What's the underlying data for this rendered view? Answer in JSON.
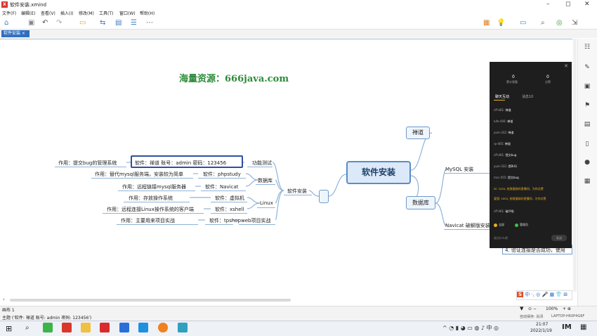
{
  "window": {
    "title": "软件安装.xmind",
    "app_icon": "X"
  },
  "menu": [
    "文件(F)",
    "编辑(E)",
    "查看(V)",
    "插入(I)",
    "修改(M)",
    "工具(T)",
    "窗口(W)",
    "帮助(H)"
  ],
  "tabs": [
    {
      "label": "软件安装 ×"
    }
  ],
  "watermark": "海量资源：666java.com",
  "mindmap": {
    "central": "软件安装",
    "right": {
      "chandao": "禅道",
      "database": "数据库",
      "mysql_install": "MySQL 安装",
      "navicat_crack": "Navicat 破解版安装",
      "verify_step": "4. 验证连接是否成功，使用"
    },
    "left": {
      "software_install": "软件安装",
      "func_test": "功能测试",
      "database": "数据库",
      "linux": "Linux",
      "web_project": "web项目实战",
      "rows": [
        {
          "desc": "作用：提交bug的管理系统",
          "soft": "软件：禅道   账号：admin   密码：123456"
        },
        {
          "desc": "作用：替代mysql服务端，安装较为简单",
          "soft": "软件：phpstudy"
        },
        {
          "desc": "作用：远程链接mysql服务器",
          "soft": "软件：Navicat"
        },
        {
          "desc": "作用：存放操作系统",
          "soft": "软件：虚拟机"
        },
        {
          "desc": "作用：远程连接Linux操作系统的客户端",
          "soft": "软件：xshell"
        },
        {
          "desc": "作用：主要用来项目实战",
          "soft": "软件：tpshop"
        }
      ]
    }
  },
  "chat": {
    "stat1_value": "0",
    "stat1_label": "累计观看",
    "stat2_value": "0",
    "stat2_label": "点赞",
    "tab_live": "聊天互动",
    "tab_msg": "消息10",
    "messages": [
      {
        "user": "cff-461:",
        "text": "禅道"
      },
      {
        "user": "lufe-456:",
        "text": "禅道"
      },
      {
        "user": "yum-332:",
        "text": "禅道"
      },
      {
        "user": "rp-465:",
        "text": "禅道"
      },
      {
        "user": "cff-461:",
        "text": "提交bug"
      },
      {
        "user": "yum-332:",
        "text": "提BUG"
      },
      {
        "user": "mcc-455:",
        "text": "提交bug"
      },
      {
        "user": "zc: coco,",
        "text": "抢救蛋糕的直播间，为你点赞"
      },
      {
        "user": "爱国: coco,",
        "text": "抢救蛋糕的直播间，为你点赞"
      },
      {
        "user": "cff-461:",
        "text": "破坏啦"
      }
    ],
    "tag1": "全部",
    "tag2": "管理员",
    "input_placeholder": "说点什么吧",
    "send": "发送"
  },
  "status": {
    "sheet": "画布 1",
    "topic": "主题 ('软件: 禅道  账号: admin  密码: 123456')",
    "autosave": "自动保存: 关闭",
    "computer": "LAPTOP-H60P4G6F",
    "zoom": "100%"
  },
  "taskbar": {
    "time": "21:07",
    "date": "2022/1/19"
  },
  "colors": {
    "accent": "#2f6fbf",
    "watermark": "#2e8b3a",
    "central_border": "#5a8cc7"
  }
}
